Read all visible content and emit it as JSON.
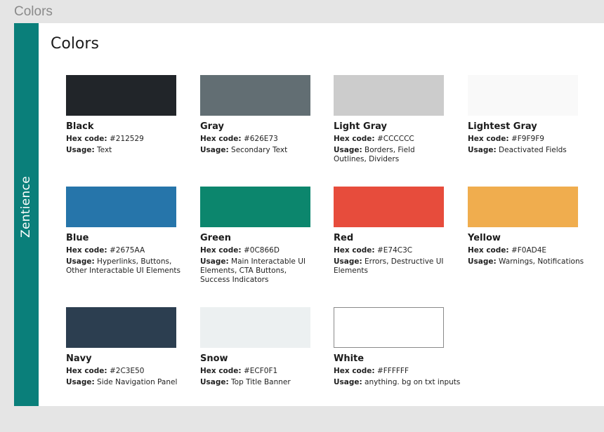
{
  "frame": {
    "label": "Colors"
  },
  "sidebar": {
    "brand": "Zentience",
    "color": "#0A7F7A"
  },
  "page": {
    "title": "Colors"
  },
  "labels": {
    "hex": "Hex code:",
    "usage": "Usage:"
  },
  "colors": [
    {
      "name": "Black",
      "hex": "#212529",
      "usage": "Text"
    },
    {
      "name": "Gray",
      "hex": "#626E73",
      "usage": "Secondary Text"
    },
    {
      "name": "Light Gray",
      "hex": "#CCCCCC",
      "usage": "Borders, Field Outlines, Dividers"
    },
    {
      "name": "Lightest Gray",
      "hex": "#F9F9F9",
      "usage": "Deactivated Fields"
    },
    {
      "name": "Blue",
      "hex": "#2675AA",
      "usage": "Hyperlinks, Buttons, Other Interactable UI Elements"
    },
    {
      "name": "Green",
      "hex": "#0C866D",
      "usage": "Main Interactable UI Elements, CTA Buttons, Success Indicators"
    },
    {
      "name": "Red",
      "hex": "#E74C3C",
      "usage": "Errors, Destructive UI Elements"
    },
    {
      "name": "Yellow",
      "hex": "#F0AD4E",
      "usage": "Warnings, Notifications"
    },
    {
      "name": "Navy",
      "hex": "#2C3E50",
      "usage": "Side Navigation Panel"
    },
    {
      "name": "Snow",
      "hex": "#ECF0F1",
      "usage": "Top Title Banner"
    },
    {
      "name": "White",
      "hex": "#FFFFFF",
      "usage": "anything. bg on txt inputs"
    }
  ]
}
